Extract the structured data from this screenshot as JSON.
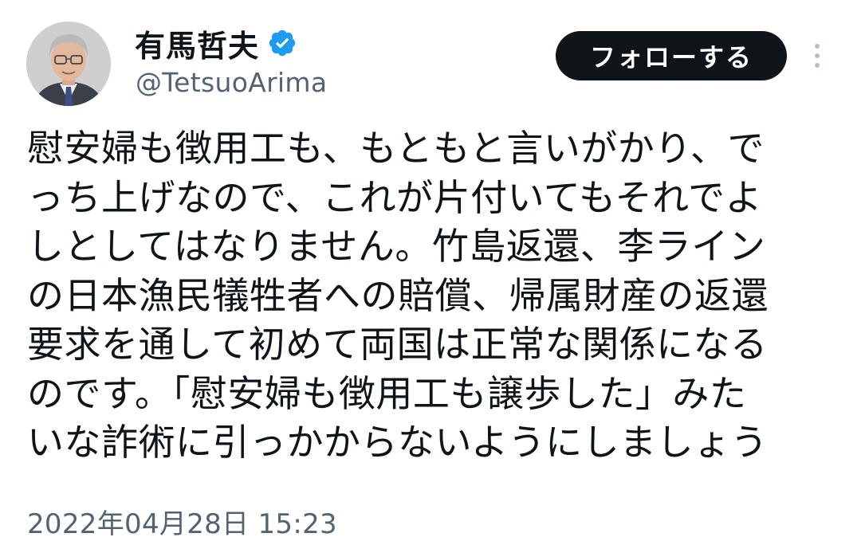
{
  "author": {
    "display_name": "有馬哲夫",
    "handle": "@TetsuoArima",
    "verified": true
  },
  "actions": {
    "follow_label": "フォローする"
  },
  "tweet": {
    "lines": [
      "慰安婦も徴用工も、もともと言いがかり、で",
      "っち上げなので、これが片付いてもそれでよ",
      "しとしてはなりません。竹島返還、李ライン",
      "の日本漁民犠牲者への賠償、帰属財産の返還",
      "要求を通して初めて両国は正常な関係になる",
      "のです。「慰安婦も徴用工も譲歩した」みた",
      "いな詐術に引っかからないようにしましょう"
    ],
    "timestamp": "2022年04月28日 15:23"
  },
  "colors": {
    "text": "#0f1419",
    "secondary": "#536471",
    "verified": "#1d9bf0",
    "follow_bg": "#0f1419"
  },
  "icons": {
    "verified": "verified-badge-icon",
    "more": "more-options-icon"
  }
}
